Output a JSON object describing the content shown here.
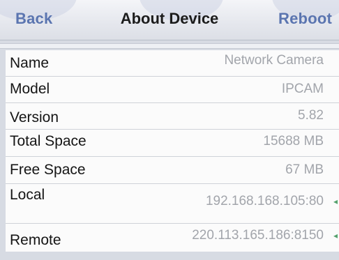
{
  "nav": {
    "back_label": "Back",
    "title": "About Device",
    "reboot_label": "Reboot"
  },
  "device_info": {
    "rows": [
      {
        "label": "Name",
        "value": "Network Camera"
      },
      {
        "label": "Model",
        "value": "IPCAM"
      },
      {
        "label": "Version",
        "value": "5.82"
      },
      {
        "label": "Total Space",
        "value": "15688 MB"
      },
      {
        "label": "Free Space",
        "value": "67 MB"
      },
      {
        "label": "Local",
        "value": "192.168.168.105:80"
      },
      {
        "label": "Remote",
        "value": "220.113.165.186:8150"
      }
    ]
  },
  "colors": {
    "nav_button": "#5b75b0",
    "value_text": "#a2a5ab",
    "row_arrow": "#55a16d"
  }
}
